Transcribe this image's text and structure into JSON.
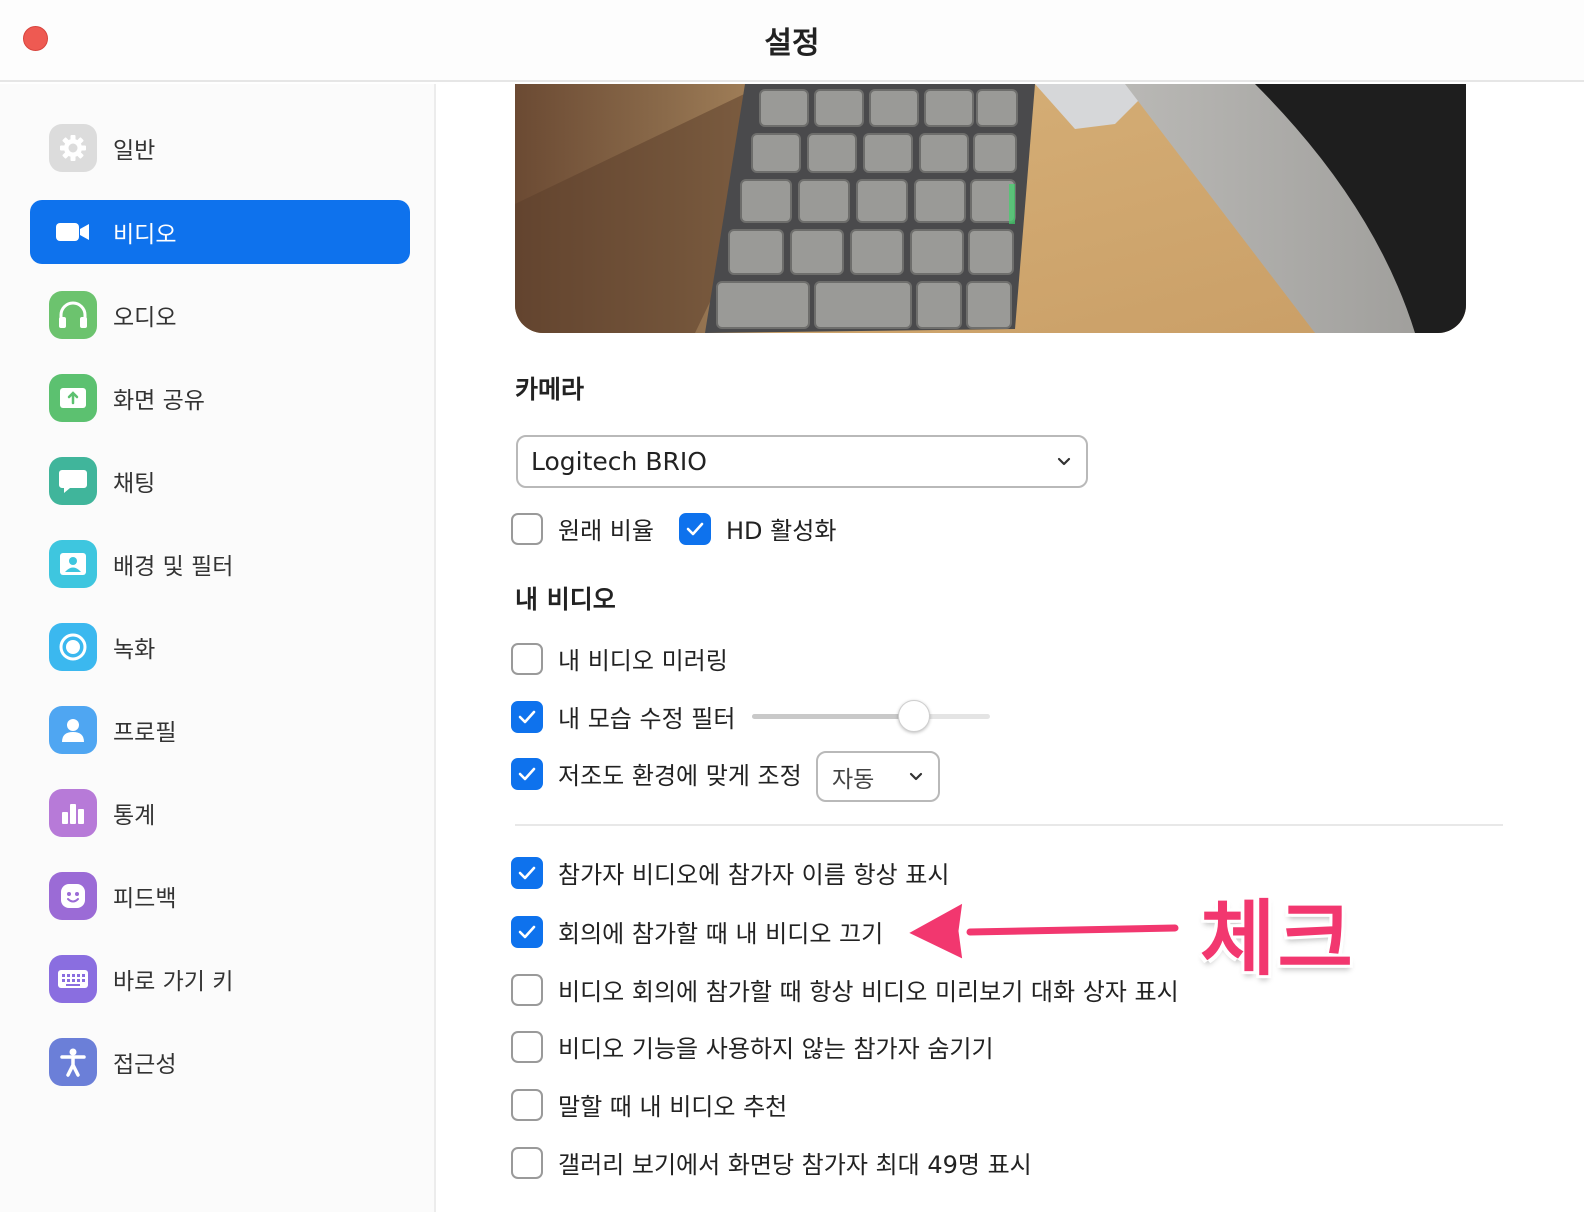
{
  "window": {
    "title": "설정"
  },
  "sidebar": {
    "active_index": 1,
    "items": [
      {
        "label": "일반",
        "icon": "gear-icon",
        "color": "#d9d9d9"
      },
      {
        "label": "비디오",
        "icon": "video-camera-icon",
        "color": "#0e72ed"
      },
      {
        "label": "오디오",
        "icon": "headphones-icon",
        "color": "#6cc36e"
      },
      {
        "label": "화면 공유",
        "icon": "screen-share-icon",
        "color": "#5cc170"
      },
      {
        "label": "채팅",
        "icon": "chat-bubble-icon",
        "color": "#40b59b"
      },
      {
        "label": "배경 및 필터",
        "icon": "background-portrait-icon",
        "color": "#3ec6df"
      },
      {
        "label": "녹화",
        "icon": "record-icon",
        "color": "#3bb8ef"
      },
      {
        "label": "프로필",
        "icon": "profile-icon",
        "color": "#4fa6f2"
      },
      {
        "label": "통계",
        "icon": "bar-chart-icon",
        "color": "#b77ad8"
      },
      {
        "label": "피드백",
        "icon": "smiley-icon",
        "color": "#9b6bd6"
      },
      {
        "label": "바로 가기 키",
        "icon": "keyboard-icon",
        "color": "#8a6ee0"
      },
      {
        "label": "접근성",
        "icon": "accessibility-icon",
        "color": "#6b7fd8"
      }
    ]
  },
  "camera": {
    "heading": "카메라",
    "selected": "Logitech BRIO",
    "options": [
      {
        "label": "원래 비율",
        "checked": false
      },
      {
        "label": "HD 활성화",
        "checked": true
      }
    ]
  },
  "my_video": {
    "heading": "내 비디오",
    "mirror": {
      "label": "내 비디오 미러링",
      "checked": false
    },
    "touch_up": {
      "label": "내 모습 수정 필터",
      "checked": true,
      "slider_value": 0.68
    },
    "low_light": {
      "label": "저조도 환경에 맞게 조정",
      "checked": true,
      "mode": "자동"
    }
  },
  "options": [
    {
      "label": "참가자 비디오에 참가자 이름 항상 표시",
      "checked": true
    },
    {
      "label": "회의에 참가할 때 내 비디오 끄기",
      "checked": true
    },
    {
      "label": "비디오 회의에 참가할 때 항상 비디오 미리보기 대화 상자 표시",
      "checked": false
    },
    {
      "label": "비디오 기능을 사용하지 않는 참가자 숨기기",
      "checked": false
    },
    {
      "label": "말할 때 내 비디오 추천",
      "checked": false
    },
    {
      "label": "갤러리 보기에서 화면당 참가자 최대 49명 표시",
      "checked": false
    }
  ],
  "annotation": {
    "text": "체크",
    "color": "#f2376f"
  }
}
